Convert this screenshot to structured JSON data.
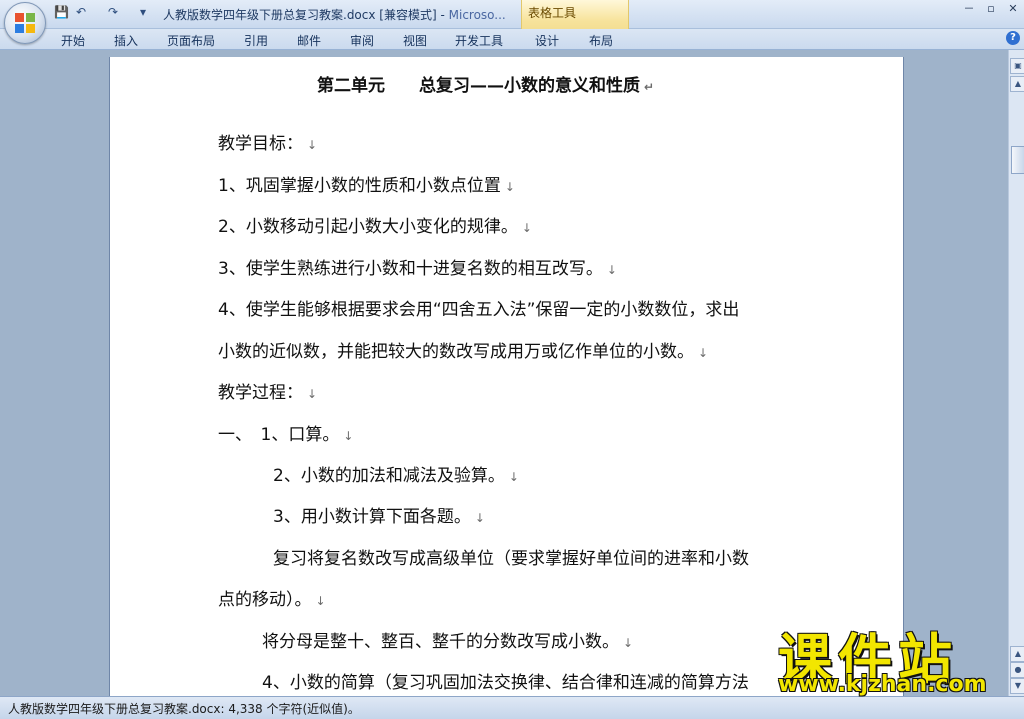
{
  "window": {
    "title": "人教版数学四年级下册总复习教案.docx [兼容模式] - ",
    "title_app": "Microso...",
    "contextual_tools": "表格工具",
    "controls": [
      "－",
      "▫",
      "✕"
    ]
  },
  "quick_access": {
    "save_icon": "save-icon",
    "undo_icon": "undo-icon",
    "redo_icon": "redo-icon"
  },
  "ribbon": {
    "tabs": [
      "开始",
      "插入",
      "页面布局",
      "引用",
      "邮件",
      "审阅",
      "视图",
      "开发工具",
      "设计",
      "布局"
    ],
    "help": "?"
  },
  "document": {
    "title": "第二单元　　总复习——小数的意义和性质",
    "lines": [
      "教学目标：",
      "1、巩固掌握小数的性质和小数点位置",
      "2、小数移动引起小数大小变化的规律。",
      "3、使学生熟练进行小数和十进复名数的相互改写。",
      "4、使学生能够根据要求会用“四舍五入法”保留一定的小数数位，求出",
      "小数的近似数，并能把较大的数改写成用万或亿作单位的小数。",
      "教学过程：",
      "一、　1、口算。",
      "2、小数的加法和减法及验算。",
      "3、用小数计算下面各题。",
      "复习将复名数改写成高级单位（要求掌握好单位间的进率和小数",
      "点的移动）。",
      "将分母是整十、整百、整千的分数改写成小数。",
      "4、小数的简算（复习巩固加法交换律、结合律和连减的简算方法"
    ],
    "para_mark": "↵",
    "line_mark": "↓"
  },
  "status": {
    "text": "人教版数学四年级下册总复习教案.docx: 4,338 个字符(近似值)。"
  },
  "watermark": {
    "text": "课件站",
    "url": "www.kjzhan.com"
  }
}
